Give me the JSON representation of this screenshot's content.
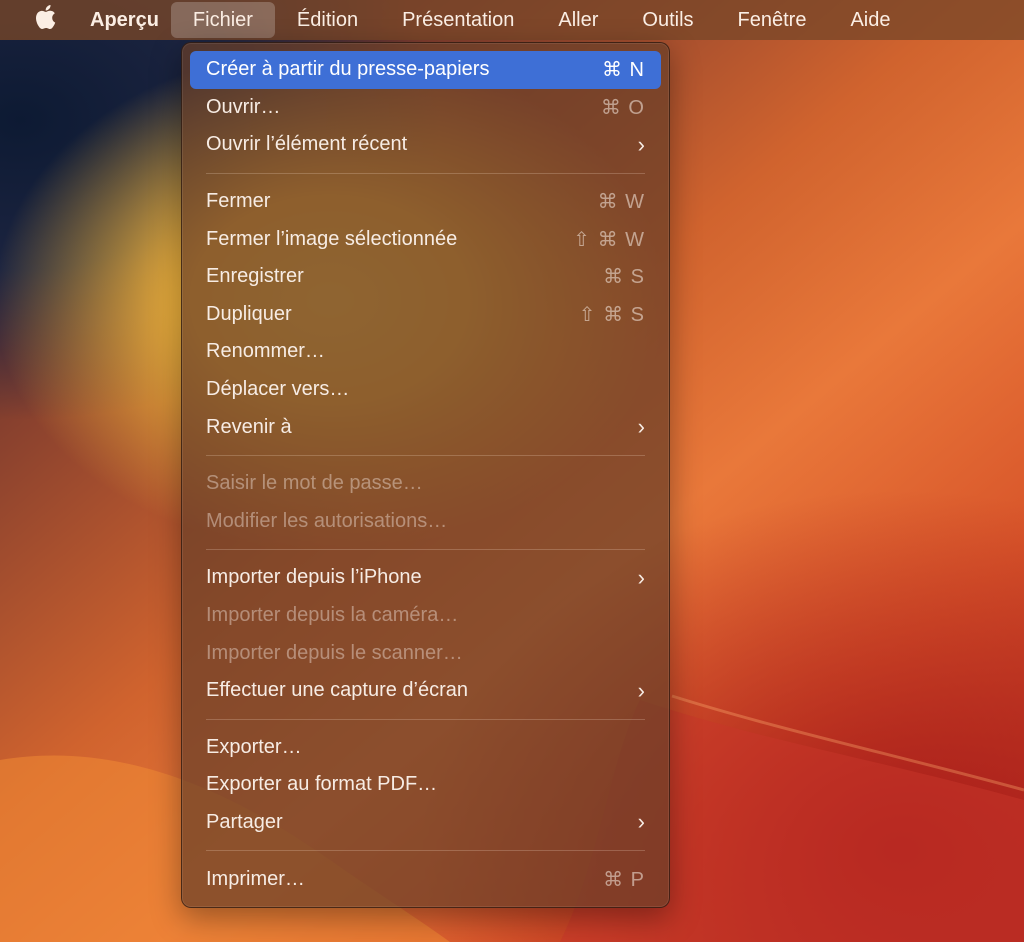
{
  "menubar": {
    "app_name": "Aperçu",
    "items": [
      {
        "label": "Fichier"
      },
      {
        "label": "Édition"
      },
      {
        "label": "Présentation"
      },
      {
        "label": "Aller"
      },
      {
        "label": "Outils"
      },
      {
        "label": "Fenêtre"
      },
      {
        "label": "Aide"
      }
    ]
  },
  "menu": {
    "groups": [
      [
        {
          "label": "Créer à partir du presse-papiers",
          "shortcut": "⌘ N"
        },
        {
          "label": "Ouvrir…",
          "shortcut": "⌘ O"
        },
        {
          "label": "Ouvrir l’élément récent",
          "submenu": "›"
        }
      ],
      [
        {
          "label": "Fermer",
          "shortcut": "⌘ W"
        },
        {
          "label": "Fermer l’image sélectionnée",
          "shortcut": "⇧ ⌘ W"
        },
        {
          "label": "Enregistrer",
          "shortcut": "⌘ S"
        },
        {
          "label": "Dupliquer",
          "shortcut": "⇧ ⌘ S"
        },
        {
          "label": "Renommer…"
        },
        {
          "label": "Déplacer vers…"
        },
        {
          "label": "Revenir à",
          "submenu": "›"
        }
      ],
      [
        {
          "label": "Saisir le mot de passe…"
        },
        {
          "label": "Modifier les autorisations…"
        }
      ],
      [
        {
          "label": "Importer depuis l’iPhone",
          "submenu": "›"
        },
        {
          "label": "Importer depuis la caméra…"
        },
        {
          "label": "Importer depuis le scanner…"
        },
        {
          "label": "Effectuer une capture d’écran",
          "submenu": "›"
        }
      ],
      [
        {
          "label": "Exporter…"
        },
        {
          "label": "Exporter au format PDF…"
        },
        {
          "label": "Partager",
          "submenu": "›"
        }
      ],
      [
        {
          "label": "Imprimer…",
          "shortcut": "⌘ P"
        }
      ]
    ]
  }
}
